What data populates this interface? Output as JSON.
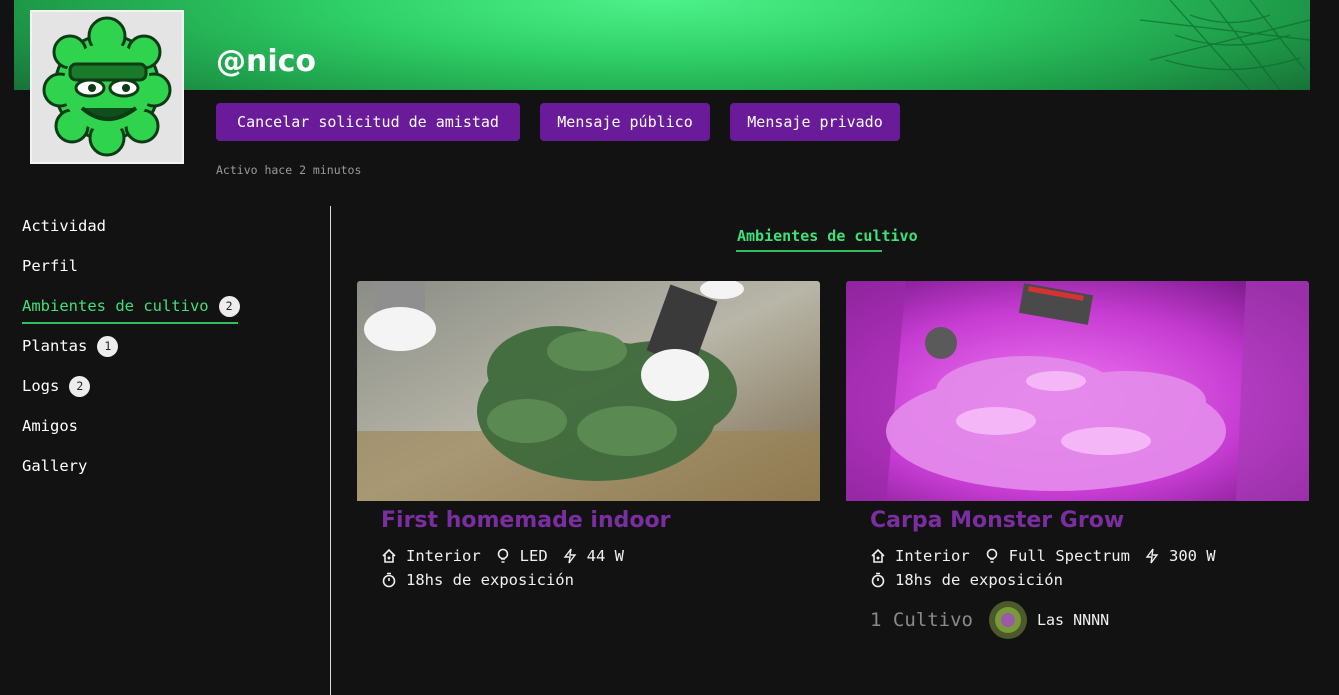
{
  "profile": {
    "username": "@nico",
    "status": "Activo hace 2 minutos"
  },
  "actions": {
    "cancel_friend": "Cancelar solicitud de amistad",
    "public_message": "Mensaje público",
    "private_message": "Mensaje privado"
  },
  "sidebar": {
    "items": [
      {
        "label": "Actividad"
      },
      {
        "label": "Perfil"
      },
      {
        "label": "Ambientes de cultivo",
        "badge": "2",
        "active": true
      },
      {
        "label": "Plantas",
        "badge": "1"
      },
      {
        "label": "Logs",
        "badge": "2"
      },
      {
        "label": "Amigos"
      },
      {
        "label": "Gallery"
      }
    ]
  },
  "section": {
    "title": "Ambientes de cultivo"
  },
  "environments": [
    {
      "title": "First homemade indoor",
      "type": "Interior",
      "light": "LED",
      "power": "44 W",
      "exposure": "18hs de exposición"
    },
    {
      "title": "Carpa Monster Grow",
      "type": "Interior",
      "light": "Full Spectrum",
      "power": "300 W",
      "exposure": "18hs de exposición",
      "cultivo_count": "1 Cultivo",
      "cultivo_name": "Las NNNN"
    }
  ],
  "colors": {
    "accent_green": "#3fe07a",
    "button_purple": "#6a1b9a",
    "title_purple": "#7b2ea0",
    "background": "#121212"
  },
  "icons": [
    "house-icon",
    "bulb-icon",
    "bolt-icon",
    "timer-icon"
  ]
}
